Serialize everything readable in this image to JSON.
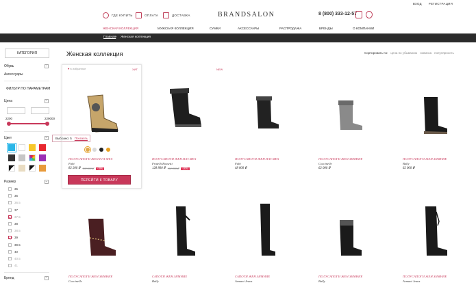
{
  "utility": {
    "login": "ВХОД",
    "register": "РЕГИСТРАЦИЯ"
  },
  "header": {
    "where_to_buy": "ГДЕ КУПИТЬ",
    "payment": "ОПЛАТА",
    "delivery": "ДОСТАВКА",
    "logo": "BRANDSALON",
    "phone": "8 (800) 333-12-57"
  },
  "nav": {
    "items": [
      "ЖЕНСКАЯ КОЛЛЕКЦИЯ",
      "МУЖСКАЯ КОЛЛЕКЦИЯ",
      "СУМКИ",
      "АКСЕССУАРЫ",
      "РАСПРОДАЖА",
      "БРЕНДЫ",
      "О КОМПАНИИ"
    ]
  },
  "breadcrumb": {
    "home": "Главная",
    "sep": "›",
    "current": "Женская коллекция"
  },
  "sidebar": {
    "category_title": "КАТЕГОРИЯ",
    "categories": [
      "Обувь",
      "Аксессуары"
    ],
    "filter_title": "ФИЛЬТР ПО ПАРАМЕТРАМ",
    "price_label": "Цена",
    "price_min": "2200",
    "price_max": "229000",
    "color_label": "Цвет",
    "swatch_colors": [
      "#29b6e8",
      "#ffffff",
      "#f7c72a",
      "#e8272f",
      "#333333",
      "#c6c6c6",
      "#ffffff",
      "#9b2fb5",
      "#ffffff",
      "#e9dcc2",
      "#ffffff",
      "#e89a3a"
    ],
    "size_label": "Размер",
    "sizes": [
      "35",
      "36",
      "36.5",
      "37",
      "37.5",
      "38",
      "38.5",
      "39",
      "39.5",
      "40",
      "40.5",
      "41"
    ],
    "sizes_checked": [
      "37.5",
      "39"
    ],
    "sizes_disabled": [
      "36.5",
      "37.5",
      "38.5",
      "40.5",
      "41"
    ],
    "brand_label": "Бренд"
  },
  "tooltip": {
    "selected": "Выбрано: 5",
    "show": "Показать"
  },
  "content": {
    "title": "Женская коллекция",
    "sort_label": "Сортировать по:",
    "sort_options": [
      "цена по убыванию",
      "новинка",
      "популярность"
    ]
  },
  "highlight_card": {
    "favorite": "в избранное",
    "badge_left": "ХИТ",
    "buy_button": "ПЕРЕЙТИ К ТОВАРУ",
    "color_dots": [
      "#e0a94a",
      "#d9d9d9",
      "#222222",
      "#e8a020"
    ]
  },
  "products_row1": [
    {
      "name": "ПОЛУСАПОГИ ЖЕН.НАТ.МЕХ",
      "brand": "Fabi",
      "price": "82 200 ₽",
      "old_price": "100 500 ₽",
      "discount": "-18%"
    },
    {
      "name": "ПОЛУСАПОГИ ЖЕН.НАТ.МЕХ",
      "brand": "Fratelli Rossetti",
      "price": "128 800 ₽",
      "old_price": "161 000 ₽",
      "discount": "-20%",
      "badge": "NEW"
    },
    {
      "name": "ПОЛУСАПОГИ ЖЕН.НАТ.МЕХ",
      "brand": "Fabi",
      "price": "48 000 ₽"
    },
    {
      "name": "ПОЛУСАПОГИ ЖЕН.ЗИМНИЕ",
      "brand": "Coccinelle",
      "price": "62 000 ₽"
    },
    {
      "name": "ПОЛУСАПОГИ ЖЕН.ЗИМНИЕ",
      "brand": "Bally",
      "price": "62 000 ₽"
    }
  ],
  "products_row2": [
    {
      "name": "ПОЛУСАПОГИ ЖЕН.ЗИМНИЕ",
      "brand": "Coccinelle"
    },
    {
      "name": "САПОГИ ЖЕН.ЗИМНИЕ",
      "brand": "Bally"
    },
    {
      "name": "САПОГИ ЖЕН.ЗИМНИЕ",
      "brand": "Armani Jeans"
    },
    {
      "name": "ПОЛУСАПОГИ ЖЕН.ЗИМНИЕ",
      "brand": "Bally"
    },
    {
      "name": "ПОЛУСАПОГИ ЖЕН.ЗИМНИЕ",
      "brand": "Armani Jeans"
    }
  ],
  "colors": {
    "accent": "#c8385a",
    "dark_bar": "#2b2b2b"
  }
}
